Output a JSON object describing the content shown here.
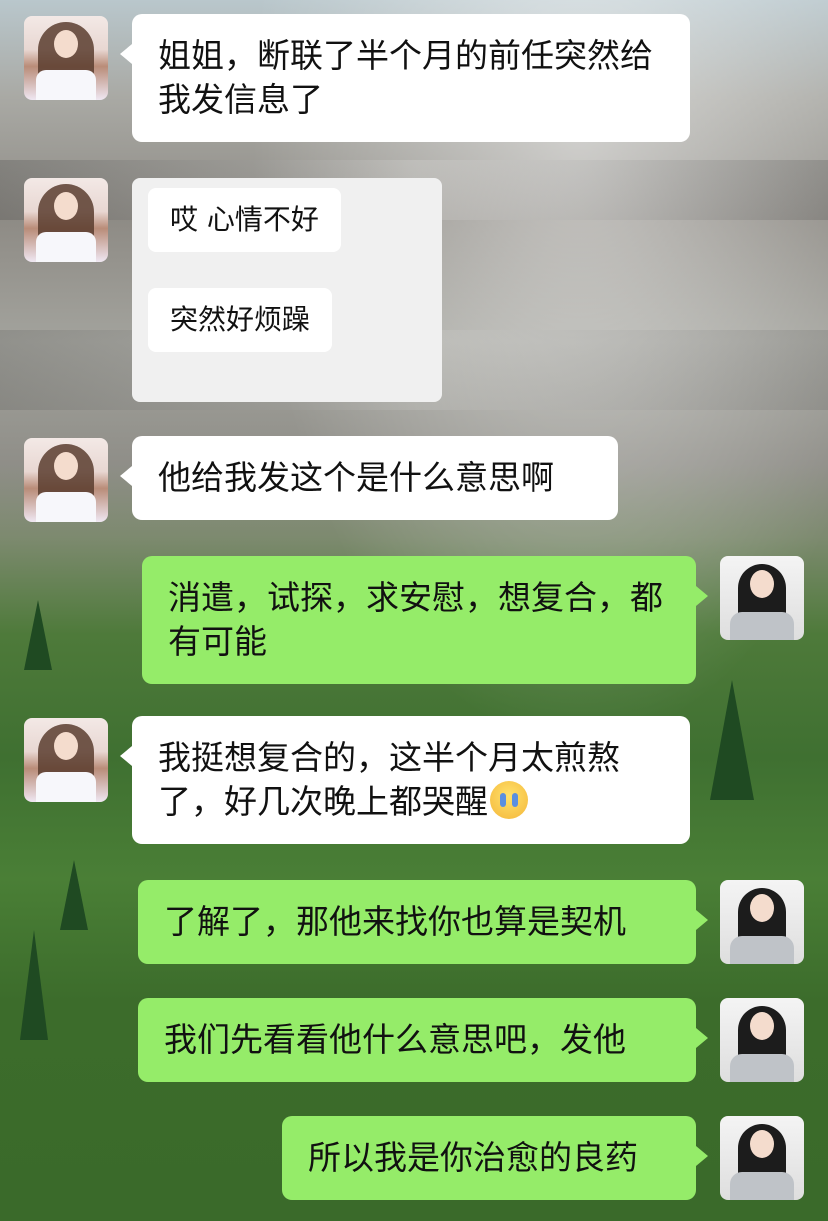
{
  "chat": {
    "messages": [
      {
        "sender": "girl",
        "side": "left",
        "text": "姐姐，断联了半个月的前任突然给我发信息了"
      },
      {
        "sender": "girl",
        "side": "left",
        "type": "forwarded_messages",
        "items": [
          "哎 心情不好",
          "突然好烦躁"
        ]
      },
      {
        "sender": "girl",
        "side": "left",
        "text": "他给我发这个是什么意思啊"
      },
      {
        "sender": "woman",
        "side": "right",
        "text": "消遣，试探，求安慰，想复合，都有可能"
      },
      {
        "sender": "girl",
        "side": "left",
        "text": "我挺想复合的，这半个月太煎熬了，好几次晚上都哭醒",
        "emoji": "crying-face"
      },
      {
        "sender": "woman",
        "side": "right",
        "text": "了解了，那他来找你也算是契机"
      },
      {
        "sender": "woman",
        "side": "right",
        "text": "我们先看看他什么意思吧，发他"
      },
      {
        "sender": "woman",
        "side": "right",
        "text": "所以我是你治愈的良药"
      }
    ]
  },
  "colors": {
    "incoming_bubble": "#ffffff",
    "outgoing_bubble": "#95ec69",
    "forward_card": "#f0f0f0"
  }
}
